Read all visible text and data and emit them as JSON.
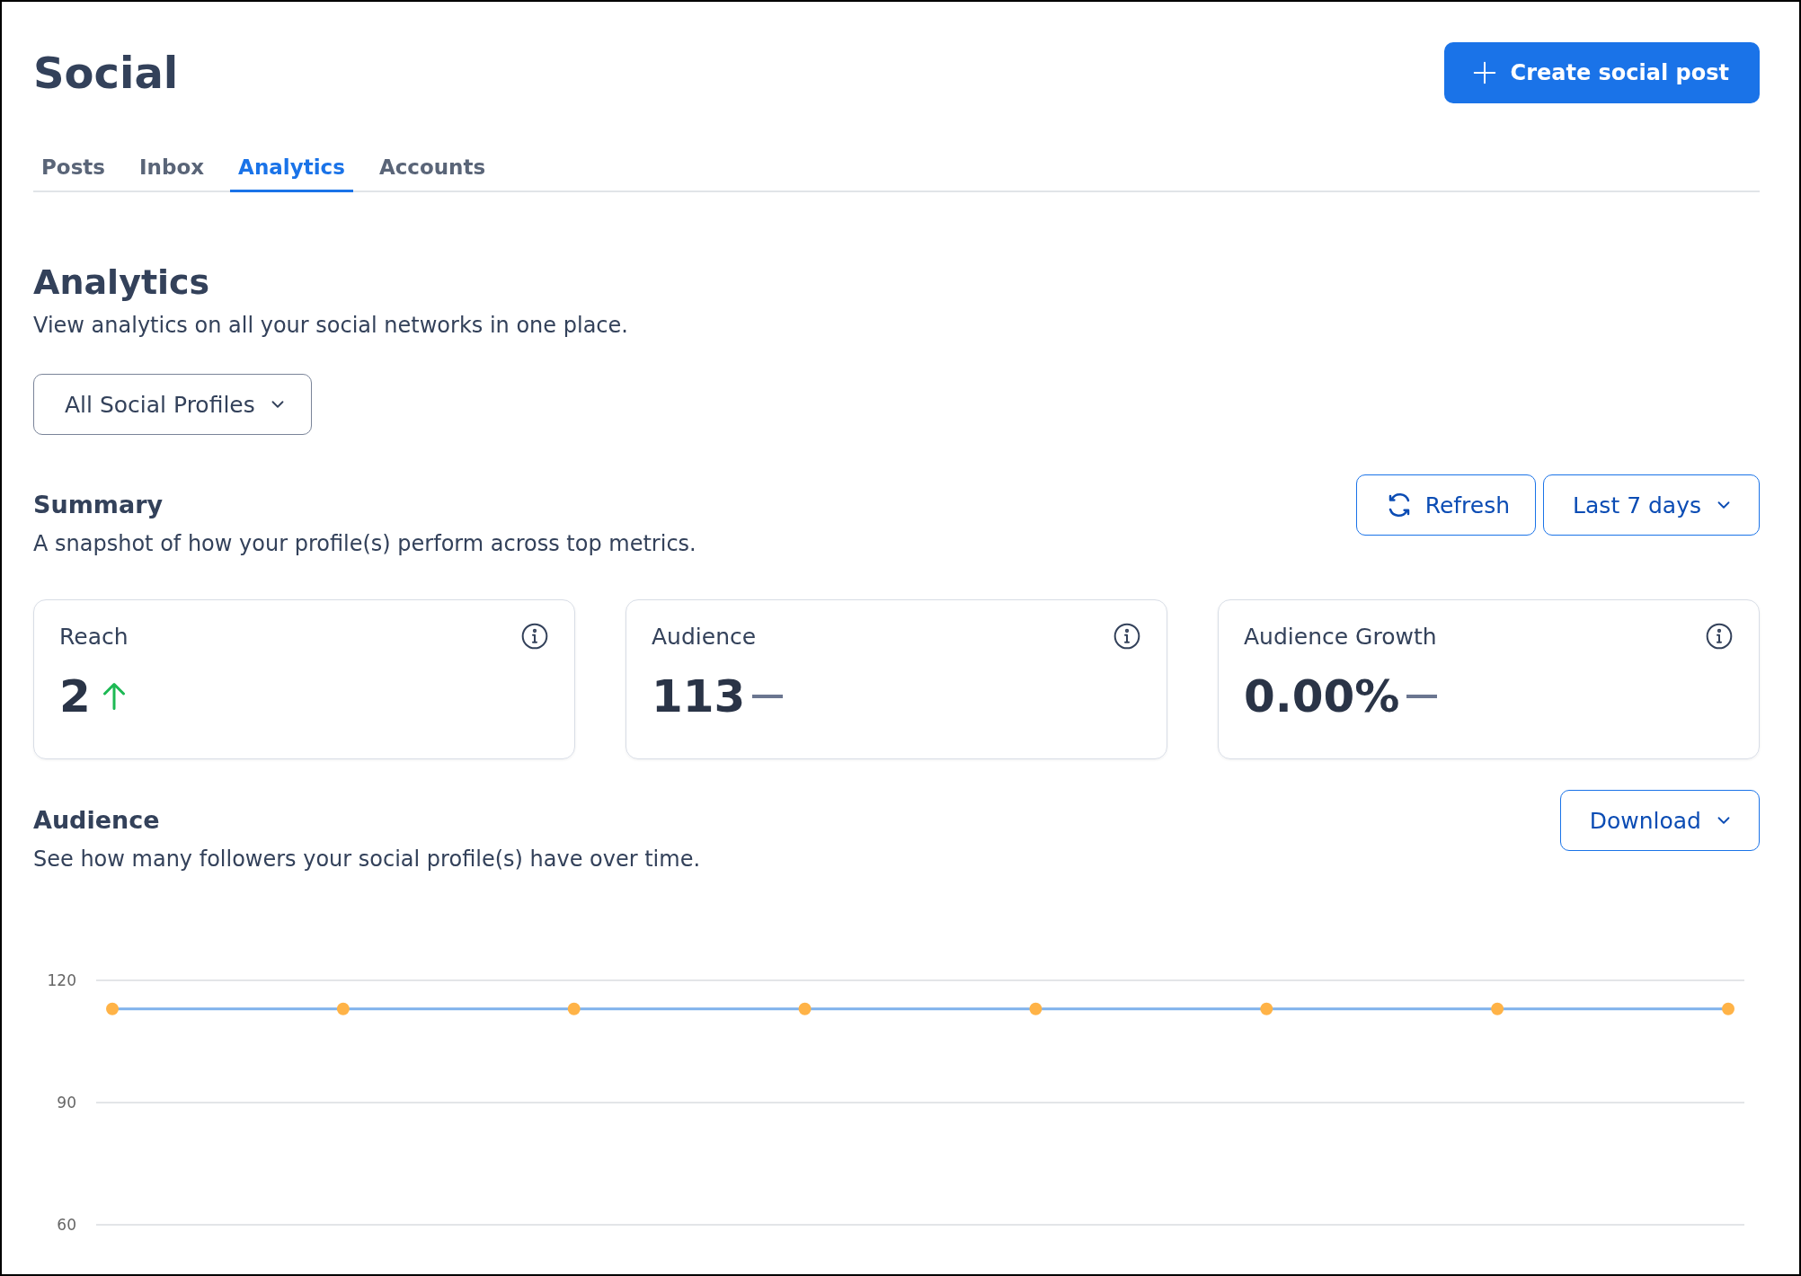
{
  "header": {
    "title": "Social",
    "create_button": "Create social post"
  },
  "tabs": [
    {
      "label": "Posts",
      "selected": false
    },
    {
      "label": "Inbox",
      "selected": false
    },
    {
      "label": "Analytics",
      "selected": true
    },
    {
      "label": "Accounts",
      "selected": false
    }
  ],
  "analytics": {
    "title": "Analytics",
    "subtitle": "View analytics on all your social networks in one place.",
    "profile_filter": "All Social Profiles"
  },
  "summary": {
    "title": "Summary",
    "subtitle": "A snapshot of how your profile(s) perform across top metrics.",
    "refresh_button": "Refresh",
    "range_dropdown": "Last 7 days",
    "cards": [
      {
        "label": "Reach",
        "value": "2",
        "kind": "up"
      },
      {
        "label": "Audience",
        "value": "113",
        "kind": "flat"
      },
      {
        "label": "Audience Growth",
        "value": "0.00%",
        "kind": "flat"
      }
    ]
  },
  "audience": {
    "title": "Audience",
    "subtitle": "See how many followers your social profile(s) have over time.",
    "download_button": "Download",
    "chart_data": {
      "type": "line",
      "ylim": [
        60,
        120
      ],
      "yticks": [
        60,
        90,
        120
      ],
      "series": [
        {
          "color": "#7fb2ec",
          "marker": true,
          "values": [
            113,
            113,
            113,
            113,
            113,
            113,
            113,
            113
          ]
        }
      ]
    }
  }
}
